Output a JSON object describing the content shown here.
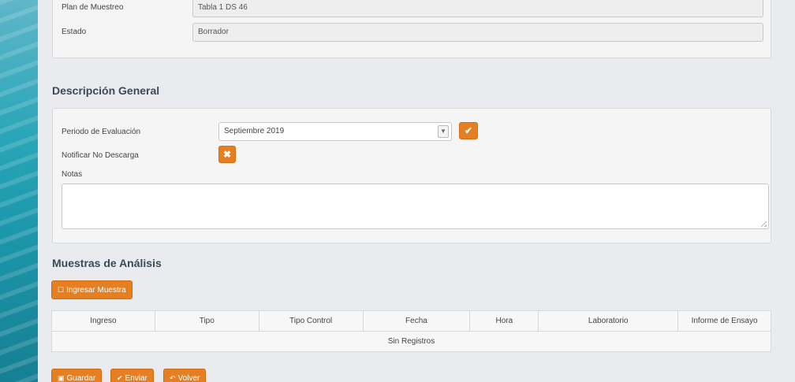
{
  "top_form": {
    "plan_label": "Plan de Muestreo",
    "plan_value": "Tabla 1 DS 46",
    "estado_label": "Estado",
    "estado_value": "Borrador"
  },
  "descripcion": {
    "title": "Descripción General",
    "periodo_label": "Periodo de Evaluación",
    "periodo_value": "Septiembre 2019",
    "notificar_label": "Notificar No Descarga",
    "notas_label": "Notas",
    "notas_value": ""
  },
  "muestras": {
    "title": "Muestras de Análisis",
    "ingresar_label": "Ingresar Muestra",
    "columns": [
      "Ingreso",
      "Tipo",
      "Tipo Control",
      "Fecha",
      "Hora",
      "Laboratorio",
      "Informe de Ensayo"
    ],
    "empty_text": "Sin Registros"
  },
  "actions": {
    "guardar_label": "Guardar",
    "enviar_label": "Enviar",
    "volver_label": "Volver"
  },
  "colors": {
    "accent": "#e67e22",
    "panel_bg": "#f5f5f5",
    "page_bg": "#e9ebee"
  },
  "icons": {
    "confirm": "check-icon",
    "notificar": "close-icon",
    "ingresar": "add-icon",
    "guardar": "save-icon",
    "enviar": "send-icon",
    "volver": "back-icon"
  }
}
